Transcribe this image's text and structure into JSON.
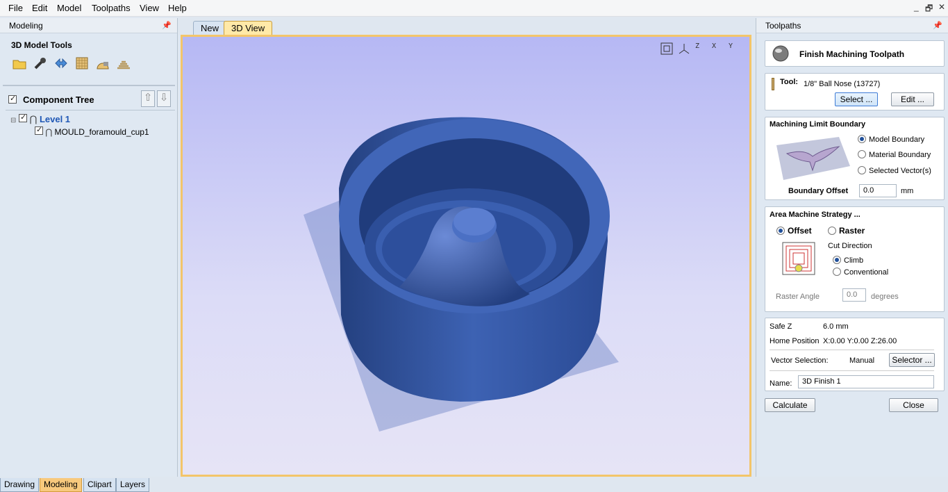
{
  "menu": [
    "File",
    "Edit",
    "Model",
    "Toolpaths",
    "View",
    "Help"
  ],
  "window_controls": {
    "minimize": "_",
    "restore": "🗗",
    "close": "✕"
  },
  "left": {
    "header": "Modeling",
    "tools_title": "3D Model Tools",
    "tool_icons": [
      "folder-icon",
      "wrench-icon",
      "arrows-icon",
      "texture-icon",
      "lock-dome-icon",
      "layers-dome-icon"
    ],
    "component_tree_label": "Component Tree",
    "tree": [
      {
        "label": "Level 1",
        "checked": true
      },
      {
        "label": "MOULD_foramould_cup1",
        "checked": true
      }
    ],
    "bottom_tabs": [
      "Drawing",
      "Modeling",
      "Clipart",
      "Layers"
    ],
    "active_tab": "Modeling"
  },
  "center": {
    "tabs": [
      "New",
      "3D View"
    ],
    "active_tab": "3D View",
    "view_icons": [
      "fit-view-icon",
      "iso-view-icon",
      "view-z-icon",
      "view-x-icon",
      "view-y-icon"
    ],
    "view_icon_labels": [
      "",
      "",
      "Z",
      "X",
      "Y"
    ]
  },
  "right": {
    "header": "Toolpaths",
    "title": "Finish Machining Toolpath",
    "tool": {
      "label": "Tool:",
      "name": "1/8\" Ball Nose (13727)",
      "select": "Select ...",
      "edit": "Edit ..."
    },
    "boundary": {
      "title": "Machining Limit Boundary",
      "options": [
        "Model Boundary",
        "Material Boundary",
        "Selected Vector(s)"
      ],
      "selected": "Model Boundary",
      "offset_label": "Boundary Offset",
      "offset_value": "0.0",
      "offset_unit": "mm"
    },
    "strategy": {
      "title": "Area Machine Strategy ...",
      "offset": "Offset",
      "raster": "Raster",
      "selected": "Offset",
      "cut_direction": "Cut Direction",
      "climb": "Climb",
      "conventional": "Conventional",
      "cut_selected": "Climb",
      "raster_angle_label": "Raster Angle",
      "raster_angle_value": "0.0",
      "raster_angle_unit": "degrees"
    },
    "settings": {
      "safe_z_label": "Safe Z",
      "safe_z": "6.0 mm",
      "home_label": "Home Position",
      "home": "X:0.00 Y:0.00 Z:26.00",
      "vector_label": "Vector Selection:",
      "vector_mode": "Manual",
      "selector": "Selector ...",
      "name_label": "Name:",
      "name_value": "3D Finish 1"
    },
    "calculate": "Calculate",
    "close": "Close"
  },
  "colors": {
    "model_blue": "#3e62b4",
    "viewport_top": "#b6b8f4",
    "viewport_bottom": "#e6e4f6",
    "tab_active": "#f8c97d"
  }
}
